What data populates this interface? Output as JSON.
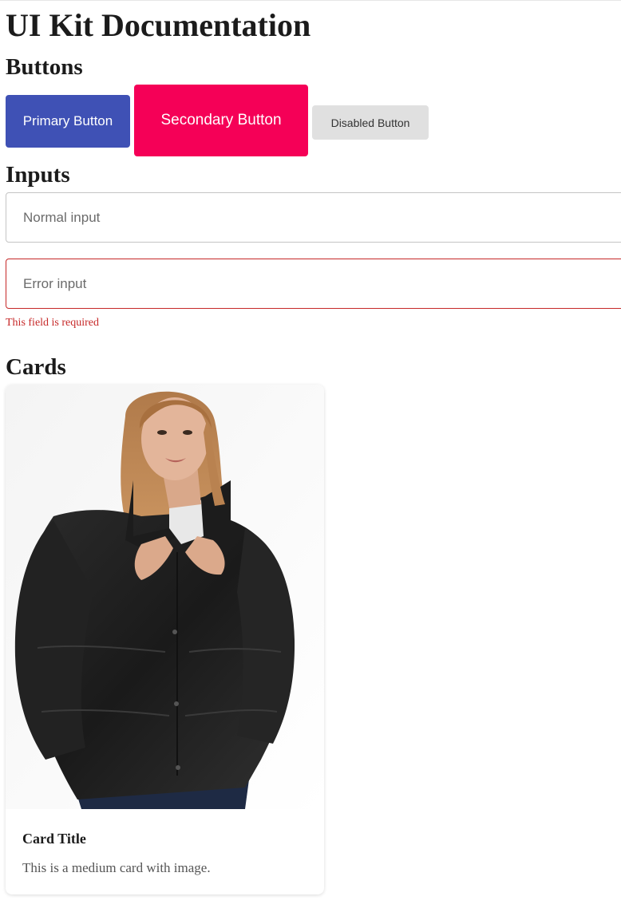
{
  "page": {
    "title": "UI Kit Documentation"
  },
  "buttons_section": {
    "heading": "Buttons",
    "primary_label": "Primary Button",
    "secondary_label": "Secondary Button",
    "disabled_label": "Disabled Button"
  },
  "inputs_section": {
    "heading": "Inputs",
    "normal_placeholder": "Normal input",
    "error_placeholder": "Error input",
    "error_message": "This field is required"
  },
  "cards_section": {
    "heading": "Cards",
    "card": {
      "title": "Card Title",
      "description": "This is a medium card with image."
    }
  },
  "colors": {
    "primary": "#3f51b5",
    "secondary": "#f50057",
    "disabled": "#e0e0e0",
    "error": "#c62828"
  }
}
